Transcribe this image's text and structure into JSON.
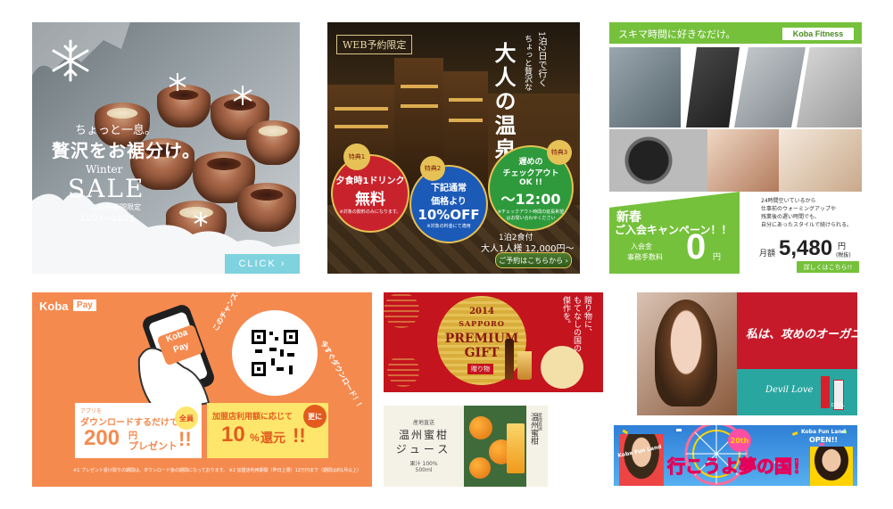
{
  "choco": {
    "line1": "ちょっと一息。",
    "line2": "贅沢をお裾分け。",
    "season": "Winter",
    "sale": "SALE",
    "period_label": "この冬期間限定",
    "period": "11/23～12/25",
    "cta": "CLICK ›"
  },
  "onsen": {
    "web_tag": "WEB予約限定",
    "subtitle_a": "1泊2日で行く",
    "subtitle_b": "ちょっと贅沢な",
    "title": "大人の温泉旅",
    "b1_tag": "特典1",
    "b1_a": "夕食時1ドリンク",
    "b1_b": "無料",
    "b1_note": "※対象の飲料のみになります。",
    "b2_tag": "特典2",
    "b2_a": "下記通常",
    "b2_b": "価格より",
    "b2_c": "10%OFF",
    "b2_note": "※対象の料金にて適用",
    "b3_tag": "特典3",
    "b3_a": "遅めの",
    "b3_b": "チェックアウト",
    "b3_c": "OK !!",
    "b3_d": "～12:00",
    "b3_note": "※チェックアウト時間の延長希望はお問い合わせください",
    "price_a": "1泊2食付",
    "price_b": "大人1人様 12,000円～",
    "cta": "ご予約はこちらから ›"
  },
  "fit": {
    "header": "スキマ時間に好きなだけ。",
    "brand": "Koba Fitness",
    "campaign_a": "新春",
    "campaign_b": "ご入会キャンペーン！！",
    "fee_label_a": "入会金",
    "fee_label_b": "事務手数料",
    "fee_value": "0",
    "fee_unit": "円",
    "desc_1": "24時間空いているから",
    "desc_2": "仕事前のウォーミングアップや",
    "desc_3": "残業後の遅い時間でも、",
    "desc_4": "自分にあったスタイルで続けられる。",
    "monthly": "月額",
    "price": "5,480",
    "price_unit": "円",
    "tax": "(税抜)",
    "cta": "詳しくはこちら!!"
  },
  "pay": {
    "brand_a": "Koba",
    "brand_b": "Pay",
    "phone_a": "Koba",
    "phone_b": "Pay",
    "arc": "このチャンスを逃すな！！",
    "arc2": "今すぐダウンロード！！",
    "l_a": "アプリを",
    "l_b": "ダウンロードするだけで",
    "l_amount": "200",
    "l_unit": "円",
    "l_c": "プレゼント",
    "l_ex": "!!",
    "l_badge": "全員",
    "r_a": "加盟店利用額に応じて",
    "r_amount": "10",
    "r_unit": "%",
    "r_c": "還元",
    "r_ex": "!!",
    "r_badge": "更に",
    "footnote": "※1 プレゼント受け取りの期間は、ダウンロード後の期間になっております。 ※2 加盟店利用期間（昨日上限）12万円まで（期間は約1月以上）"
  },
  "prem": {
    "year": "2014",
    "place": "SAPPORO",
    "title_a": "PREMIUM",
    "title_b": "GIFT",
    "sub": "贈り物",
    "v1": "贈り物に、",
    "v2": "もてなしの国の",
    "v3": "傑作を。"
  },
  "mikan": {
    "small": "産地直送",
    "title_a": "温州蜜柑",
    "title_b": "ジュース",
    "note_a": "果汁 100%",
    "note_b": "500ml",
    "side_small": "産地直送",
    "side": "温州蜜柑"
  },
  "model": {
    "copy": "私は、攻めのオーガニック。",
    "brand": "Devil Love",
    "bottle": "DEVIL"
  },
  "ferris": {
    "title": "行こうよ夢の国！",
    "left": "Koba Fun Land",
    "badge": "20th",
    "right_a": "Koba Fun Land",
    "right_b": "OPEN!!"
  },
  "colors": {
    "onsen_red": "#c8232c",
    "onsen_blue": "#1c5ab8",
    "onsen_green": "#2e9a3c",
    "fitness_green": "#75c13b",
    "pay_orange": "#f58a4f",
    "premium_red": "#c4141e",
    "gold": "#e6c155"
  }
}
